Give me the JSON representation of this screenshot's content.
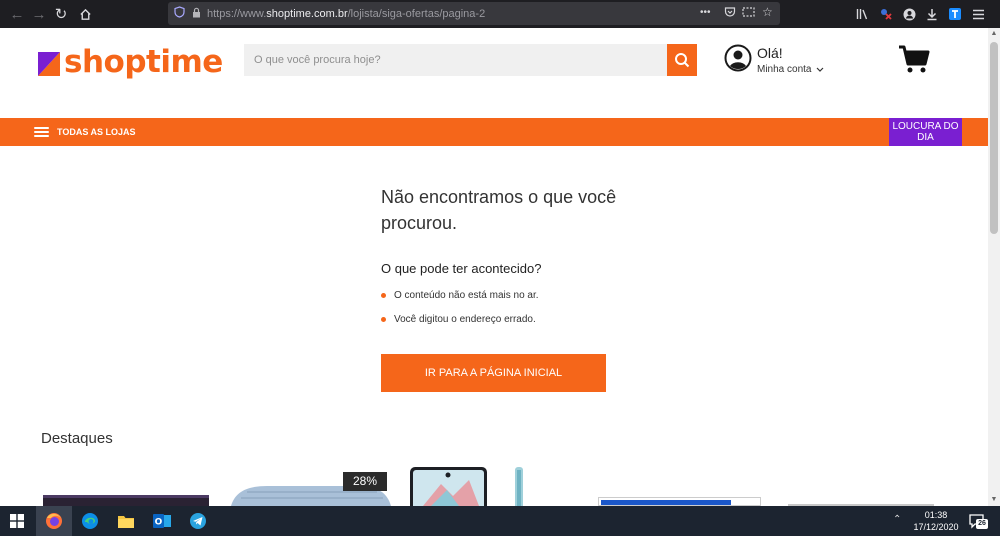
{
  "browser": {
    "url_prefix": "https://www.",
    "url_domain": "shoptime.com.br",
    "url_path": "/lojista/siga-ofertas/pagina-2",
    "menu_dots": "•••"
  },
  "header": {
    "logo_text": "shoptime",
    "search_placeholder": "O que você procura hoje?",
    "greeting": "Olá!",
    "account_label": "Minha conta"
  },
  "nav": {
    "all_stores": "TODAS AS LOJAS",
    "deal_of_day": "LOUCURA DO DIA"
  },
  "error": {
    "title": "Não encontramos o que você procurou.",
    "subtitle": "O que pode ter acontecido?",
    "reasons": [
      "O conteúdo não está mais no ar.",
      "Você digitou o endereço errado."
    ],
    "home_button": "IR PARA A PÁGINA INICIAL"
  },
  "highlights": {
    "heading": "Destaques",
    "discount_badge": "28%"
  },
  "taskbar": {
    "time": "01:38",
    "date": "17/12/2020",
    "notifications": "26"
  },
  "colors": {
    "brand_orange": "#f5661a",
    "deal_purple": "#7a1fd1"
  }
}
